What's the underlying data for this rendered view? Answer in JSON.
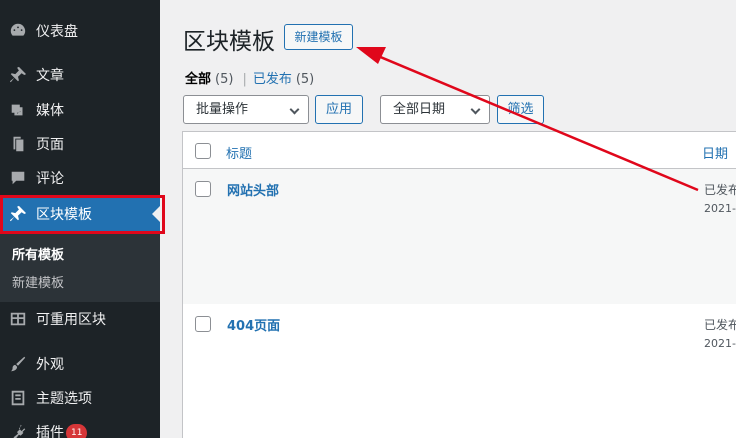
{
  "sidebar": {
    "items": [
      {
        "label": "仪表盘",
        "icon": "dashboard-icon"
      },
      {
        "label": "文章",
        "icon": "pin-icon"
      },
      {
        "label": "媒体",
        "icon": "media-icon"
      },
      {
        "label": "页面",
        "icon": "page-icon"
      },
      {
        "label": "评论",
        "icon": "comment-icon"
      },
      {
        "label": "区块模板",
        "icon": "pin-icon"
      },
      {
        "label": "可重用区块",
        "icon": "table-icon"
      },
      {
        "label": "外观",
        "icon": "brush-icon"
      },
      {
        "label": "主题选项",
        "icon": "theme-options-icon"
      },
      {
        "label": "插件",
        "icon": "plugin-icon",
        "badge": "11"
      }
    ],
    "submenu": [
      {
        "label": "所有模板"
      },
      {
        "label": "新建模板"
      }
    ]
  },
  "main": {
    "title": "区块模板",
    "add_new_label": "新建模板",
    "status_links": {
      "all_label": "全部",
      "all_count": "(5)",
      "separator": "|",
      "published_label": "已发布",
      "published_count": "(5)"
    },
    "bulk_action": {
      "selected": "批量操作"
    },
    "apply_label": "应用",
    "date_filter": {
      "selected": "全部日期"
    },
    "filter_label": "筛选",
    "table": {
      "columns": {
        "title": "标题",
        "date": "日期"
      },
      "rows": [
        {
          "title": "网站头部",
          "status": "已发布",
          "date": "2021-"
        },
        {
          "title": "404页面",
          "status": "已发布",
          "date": "2021-"
        }
      ]
    }
  },
  "annotation": {
    "color": "#e0071b"
  },
  "colors": {
    "sidebar_bg": "#1d2327",
    "accent": "#2271b1",
    "badge": "#d63638"
  }
}
